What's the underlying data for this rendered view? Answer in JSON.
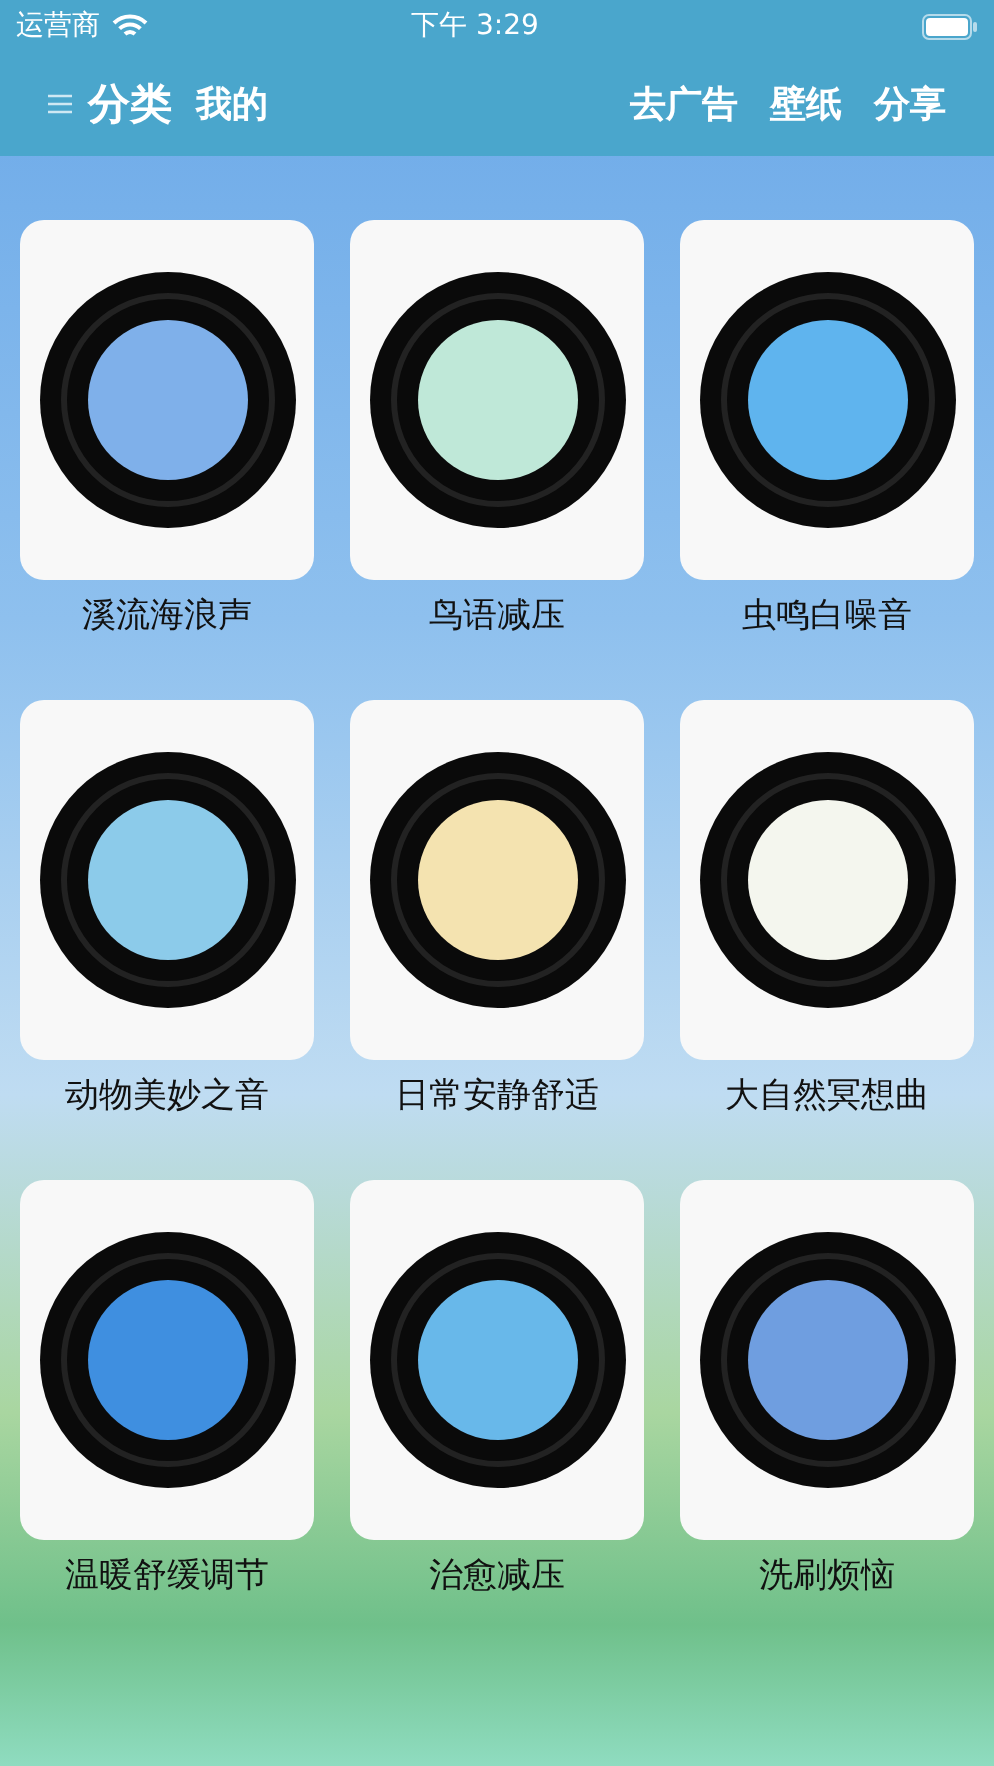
{
  "status_bar": {
    "carrier": "运营商",
    "time": "下午 3:29"
  },
  "nav": {
    "tabs": [
      {
        "label": "分类",
        "selected": true
      },
      {
        "label": "我的",
        "selected": false
      }
    ],
    "actions": [
      "去广告",
      "壁纸",
      "分享"
    ]
  },
  "albums": [
    {
      "title": "溪流海浪声",
      "color": "#7fb0ea"
    },
    {
      "title": "鸟语减压",
      "color": "#bfe8d8"
    },
    {
      "title": "虫鸣白噪音",
      "color": "#5fb4ee"
    },
    {
      "title": "动物美妙之音",
      "color": "#8ccbea"
    },
    {
      "title": "日常安静舒适",
      "color": "#f4e3b0"
    },
    {
      "title": "大自然冥想曲",
      "color": "#f4f6ee"
    },
    {
      "title": "温暖舒缓调节",
      "color": "#3f8fe0"
    },
    {
      "title": "治愈减压",
      "color": "#68b8ea"
    },
    {
      "title": "洗刷烦恼",
      "color": "#6f9ee0"
    }
  ]
}
